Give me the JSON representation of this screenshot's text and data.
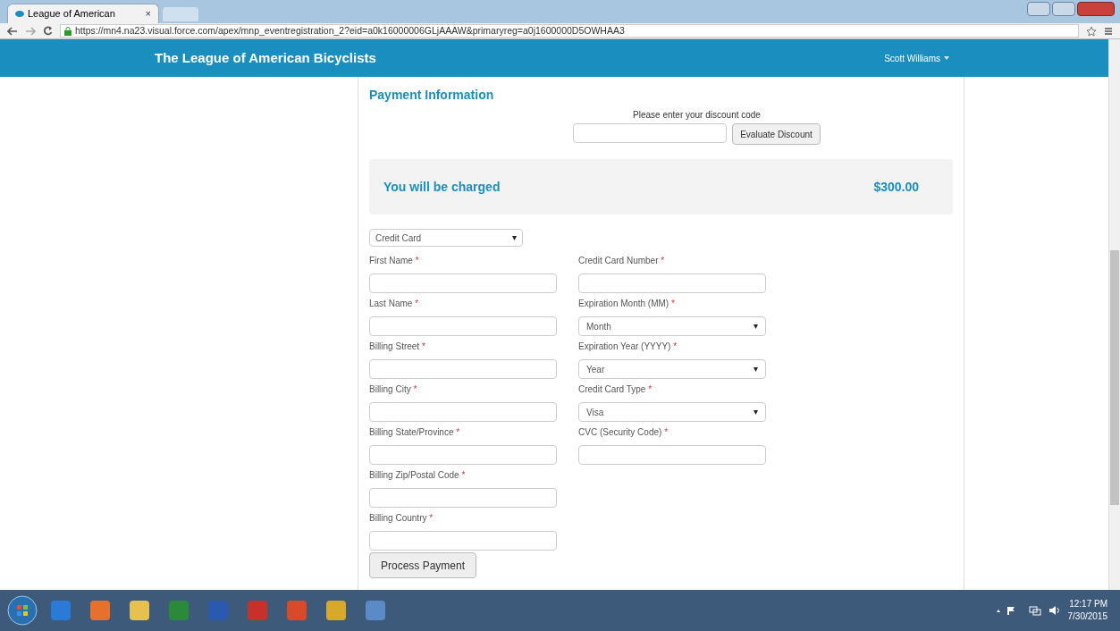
{
  "browser": {
    "tab_title": "League of American",
    "tab_close": "×",
    "url": "https://mn4.na23.visual.force.com/apex/mnp_eventregistration_2?eid=a0k16000006GLjAAAW&primaryreg=a0j1600000D5OWHAA3"
  },
  "nav": {
    "brand": "The League of American Bicyclists",
    "user": "Scott Williams"
  },
  "section_title": "Payment Information",
  "discount": {
    "prompt": "Please enter your discount code",
    "button": "Evaluate Discount"
  },
  "charge": {
    "label": "You will be charged",
    "amount": "$300.00"
  },
  "payment_method": {
    "value": "Credit Card"
  },
  "left_fields": [
    {
      "label": "First Name",
      "mark": "*",
      "kind": "text"
    },
    {
      "label": "Last Name",
      "mark": "*",
      "kind": "text"
    },
    {
      "label": "Billing Street",
      "mark": "*",
      "kind": "text"
    },
    {
      "label": "Billing City",
      "mark": "*",
      "kind": "text"
    },
    {
      "label": "Billing State/Province",
      "mark": "*",
      "kind": "text"
    },
    {
      "label": "Billing Zip/Postal Code",
      "mark": "*",
      "kind": "text"
    },
    {
      "label": "Billing Country",
      "mark": "*",
      "kind": "text"
    }
  ],
  "right_fields": [
    {
      "label": "Credit Card Number",
      "mark": "*",
      "kind": "text"
    },
    {
      "label": "Expiration Month (MM)",
      "mark": "*",
      "kind": "select",
      "value": "Month"
    },
    {
      "label": "Expiration Year (YYYY)",
      "mark": "*",
      "kind": "select",
      "value": "Year"
    },
    {
      "label": "Credit Card Type",
      "mark": "*",
      "kind": "select",
      "value": "Visa"
    },
    {
      "label": "CVC (Security Code)",
      "mark": "*",
      "kind": "text"
    }
  ],
  "submit": "Process Payment",
  "taskbar": {
    "time": "12:17 PM",
    "date": "7/30/2015"
  }
}
